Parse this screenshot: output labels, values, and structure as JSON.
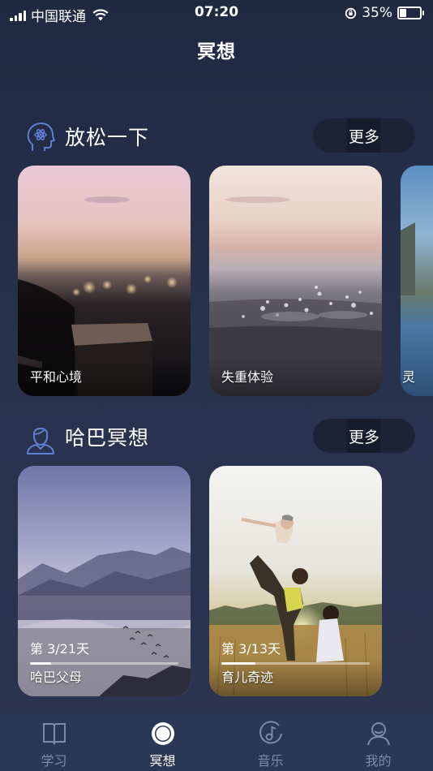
{
  "status_bar": {
    "carrier": "中国联通",
    "time": "07:20",
    "battery": "35%",
    "battery_level": 0.35
  },
  "page_title": "冥想",
  "sections": [
    {
      "title": "放松一下",
      "icon": "head-atom-icon",
      "more_label": "更多",
      "cards": [
        {
          "label": "平和心境"
        },
        {
          "label": "失重体验"
        },
        {
          "label": "灵"
        }
      ]
    },
    {
      "title": "哈巴冥想",
      "icon": "person-icon",
      "more_label": "更多",
      "cards": [
        {
          "label": "哈巴父母",
          "progress_text": "第 3/21天",
          "progress": 0.14
        },
        {
          "label": "育儿奇迹",
          "progress_text": "第 3/13天",
          "progress": 0.23
        }
      ]
    }
  ],
  "tabs": [
    {
      "label": "学习",
      "icon": "book-icon",
      "active": false
    },
    {
      "label": "冥想",
      "icon": "circle-icon",
      "active": true
    },
    {
      "label": "音乐",
      "icon": "music-disc-icon",
      "active": false
    },
    {
      "label": "我的",
      "icon": "user-icon",
      "active": false
    }
  ]
}
